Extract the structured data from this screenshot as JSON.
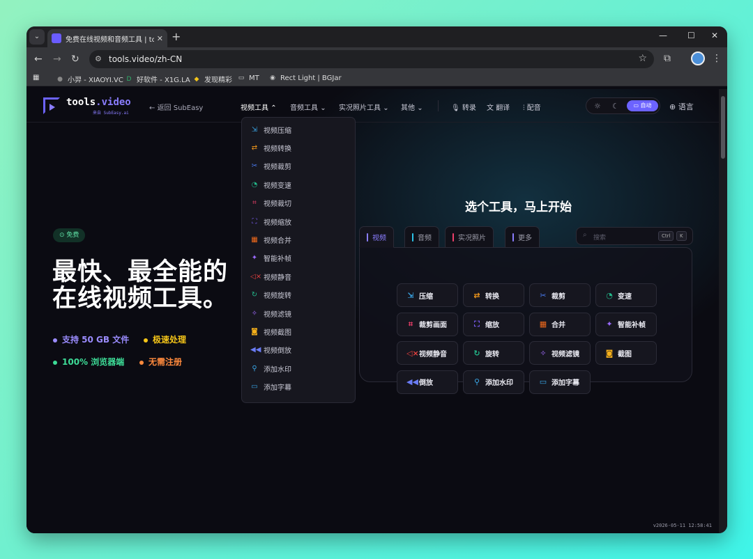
{
  "browser": {
    "tab_title": "免费在线视频和音频工具 | tools.video",
    "url": "tools.video/zh-CN",
    "bookmarks": [
      {
        "label": "小羿 - XIAOYI.VC",
        "icon": "avatar-icon",
        "color": "#888888"
      },
      {
        "label": "好软件 - X1G.LA",
        "icon": "x1g-icon",
        "color": "#2fb36b"
      },
      {
        "label": "发现精彩",
        "icon": "bolt-icon",
        "color": "#f4c51b"
      },
      {
        "label": "MT",
        "icon": "folder-icon",
        "color": "#cccccc"
      },
      {
        "label": "Rect Light | BGJar",
        "icon": "globe-icon",
        "color": "#cccccc"
      }
    ]
  },
  "header": {
    "logo_name": "tools",
    "logo_dot": ".video",
    "logo_sub": "来自 SubEasy.ai",
    "back_link": "返回 SubEasy",
    "nav": [
      {
        "label": "视频工具",
        "chevron": "⌃",
        "active": true
      },
      {
        "label": "音频工具",
        "chevron": "⌄"
      },
      {
        "label": "实况照片工具",
        "chevron": "⌄"
      },
      {
        "label": "其他",
        "chevron": "⌄"
      }
    ],
    "actions": [
      {
        "label": "转录",
        "icon": "mic-icon"
      },
      {
        "label": "翻译",
        "icon": "translate-icon"
      },
      {
        "label": "配音",
        "icon": "waveform-icon"
      }
    ],
    "theme_auto": "自动",
    "language": "语言",
    "accent": "#6c63ff"
  },
  "dropdown": {
    "items": [
      {
        "label": "视频压缩",
        "icon": "compress-icon",
        "glyph": "⇲",
        "color": "#3aa7e8"
      },
      {
        "label": "视频转换",
        "icon": "convert-icon",
        "glyph": "⇄",
        "color": "#f59a1b"
      },
      {
        "label": "视频裁剪",
        "icon": "scissors-icon",
        "glyph": "✂",
        "color": "#4a7bf0"
      },
      {
        "label": "视频变速",
        "icon": "speed-icon",
        "glyph": "◔",
        "color": "#23b88a"
      },
      {
        "label": "视频裁切",
        "icon": "crop-icon",
        "glyph": "⌗",
        "color": "#ef3f6a"
      },
      {
        "label": "视频缩放",
        "icon": "scale-icon",
        "glyph": "⛶",
        "color": "#7a5cf0"
      },
      {
        "label": "视频合并",
        "icon": "merge-icon",
        "glyph": "▦",
        "color": "#f26a1b"
      },
      {
        "label": "智能补帧",
        "icon": "sparkle-icon",
        "glyph": "✦",
        "color": "#9b6bff"
      },
      {
        "label": "视频静音",
        "icon": "mute-icon",
        "glyph": "◁×",
        "color": "#e8413f"
      },
      {
        "label": "视频旋转",
        "icon": "rotate-icon",
        "glyph": "↻",
        "color": "#23b88a"
      },
      {
        "label": "视频滤镜",
        "icon": "filter-icon",
        "glyph": "✧",
        "color": "#a36bff"
      },
      {
        "label": "视频截图",
        "icon": "camera-icon",
        "glyph": "◙",
        "color": "#f5b01b"
      },
      {
        "label": "视频倒放",
        "icon": "rewind-icon",
        "glyph": "◀◀",
        "color": "#6a7cf5"
      },
      {
        "label": "添加水印",
        "icon": "stamp-icon",
        "glyph": "⚲",
        "color": "#3aa7e8"
      },
      {
        "label": "添加字幕",
        "icon": "subtitle-icon",
        "glyph": "▭",
        "color": "#3aa7e8"
      }
    ]
  },
  "hero": {
    "badge": "免费",
    "title_line1": "最快、最全能的",
    "title_line2": "在线视频工具。",
    "features": [
      {
        "label": "支持 50 GB 文件",
        "color": "#9b8cff"
      },
      {
        "label": "极速处理",
        "color": "#f5c518"
      },
      {
        "label": "100% 浏览器端",
        "color": "#3ddc97"
      },
      {
        "label": "无需注册",
        "color": "#ff8a3d"
      }
    ]
  },
  "tools_panel": {
    "heading": "选个工具，马上开始",
    "tabs": [
      {
        "label": "视频",
        "color": "#8a7dff"
      },
      {
        "label": "音频",
        "color": "#2bc3e8"
      },
      {
        "label": "实况照片",
        "color": "#ef3f6a"
      },
      {
        "label": "更多",
        "color": "#8a7dff"
      }
    ],
    "search_placeholder": "搜索",
    "shortcut": [
      "Ctrl",
      "K"
    ],
    "buttons": [
      {
        "label": "压缩",
        "icon": "compress-icon",
        "glyph": "⇲",
        "color": "#3aa7e8"
      },
      {
        "label": "转换",
        "icon": "convert-icon",
        "glyph": "⇄",
        "color": "#f59a1b"
      },
      {
        "label": "裁剪",
        "icon": "scissors-icon",
        "glyph": "✂",
        "color": "#4a7bf0"
      },
      {
        "label": "变速",
        "icon": "speed-icon",
        "glyph": "◔",
        "color": "#23b88a"
      },
      {
        "label": "裁剪画面",
        "icon": "crop-icon",
        "glyph": "⌗",
        "color": "#ef3f6a"
      },
      {
        "label": "缩放",
        "icon": "scale-icon",
        "glyph": "⛶",
        "color": "#7a5cf0"
      },
      {
        "label": "合并",
        "icon": "merge-icon",
        "glyph": "▦",
        "color": "#f26a1b"
      },
      {
        "label": "智能补帧",
        "icon": "sparkle-icon",
        "glyph": "✦",
        "color": "#9b6bff"
      },
      {
        "label": "视频静音",
        "icon": "mute-icon",
        "glyph": "◁×",
        "color": "#e8413f"
      },
      {
        "label": "旋转",
        "icon": "rotate-icon",
        "glyph": "↻",
        "color": "#23b88a"
      },
      {
        "label": "视频滤镜",
        "icon": "filter-icon",
        "glyph": "✧",
        "color": "#a36bff"
      },
      {
        "label": "截图",
        "icon": "camera-icon",
        "glyph": "◙",
        "color": "#f5b01b"
      },
      {
        "label": "倒放",
        "icon": "rewind-icon",
        "glyph": "◀◀",
        "color": "#6a7cf5"
      },
      {
        "label": "添加水印",
        "icon": "stamp-icon",
        "glyph": "⚲",
        "color": "#3aa7e8"
      },
      {
        "label": "添加字幕",
        "icon": "subtitle-icon",
        "glyph": "▭",
        "color": "#3aa7e8"
      }
    ]
  },
  "footer": {
    "version": "v2026-05-11 12:58:41"
  }
}
